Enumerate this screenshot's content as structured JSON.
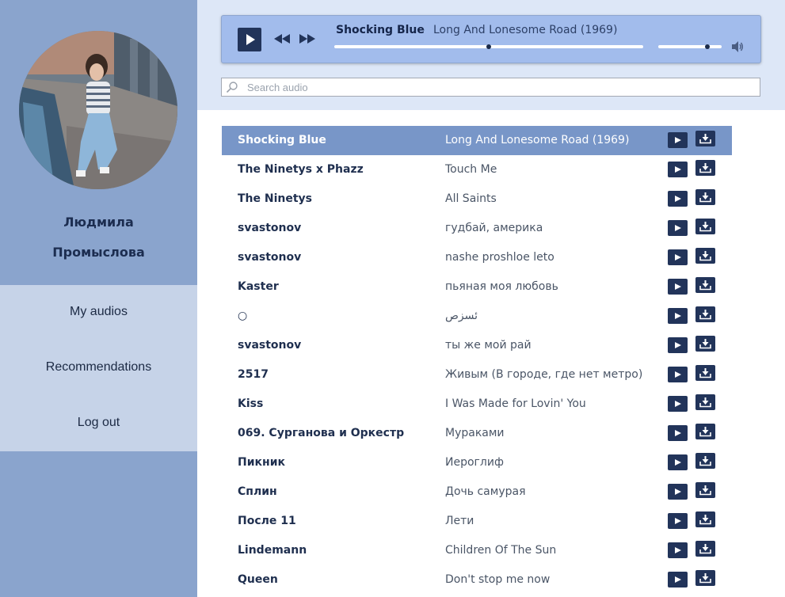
{
  "user": {
    "first_name": "Людмила",
    "last_name": "Промыслова"
  },
  "nav": [
    {
      "label": "My audios"
    },
    {
      "label": "Recommendations"
    },
    {
      "label": "Log out"
    }
  ],
  "player": {
    "artist": "Shocking Blue",
    "separator": "-",
    "title": "Long And Lonesome Road (1969)",
    "progress": 0.5,
    "volume": 0.78
  },
  "search": {
    "placeholder": "Search audio",
    "value": ""
  },
  "tracks": [
    {
      "artist": "Shocking Blue",
      "title": "Long And Lonesome Road (1969)",
      "active": true
    },
    {
      "artist": "The Ninetys x Phazz",
      "title": "Touch Me"
    },
    {
      "artist": "The Ninetys",
      "title": "All Saints"
    },
    {
      "artist": "svastonov",
      "title": "гудбай, америка"
    },
    {
      "artist": "svastonov",
      "title": "nashe proshloe leto"
    },
    {
      "artist": "Kaster",
      "title": "пьяная моя любовь"
    },
    {
      "artist": "○",
      "title": "ئسزص"
    },
    {
      "artist": "svastonov",
      "title": "ты же мой рай"
    },
    {
      "artist": "2517",
      "title": "Живым (В городе, где нет метро)"
    },
    {
      "artist": "Kiss",
      "title": "I Was Made for Lovin' You"
    },
    {
      "artist": "069. Сурганова и Оркестр",
      "title": "Мураками"
    },
    {
      "artist": "Пикник",
      "title": "Иероглиф"
    },
    {
      "artist": "Сплин",
      "title": "Дочь самурая"
    },
    {
      "artist": "После 11",
      "title": "Лети"
    },
    {
      "artist": "Lindemann",
      "title": "Children Of The Sun"
    },
    {
      "artist": "Queen",
      "title": "Don't stop me now"
    }
  ],
  "colors": {
    "sidebar": "#8aa4cd",
    "nav_bg": "#c6d3e8",
    "header_bg": "#dde7f7",
    "player_bg": "#a2bcec",
    "active_row": "#7896c8",
    "button": "#22345a"
  },
  "icons": {
    "play": "play-icon",
    "rewind": "rewind-icon",
    "forward": "forward-icon",
    "volume": "speaker-icon",
    "search": "search-icon",
    "download": "download-icon"
  }
}
